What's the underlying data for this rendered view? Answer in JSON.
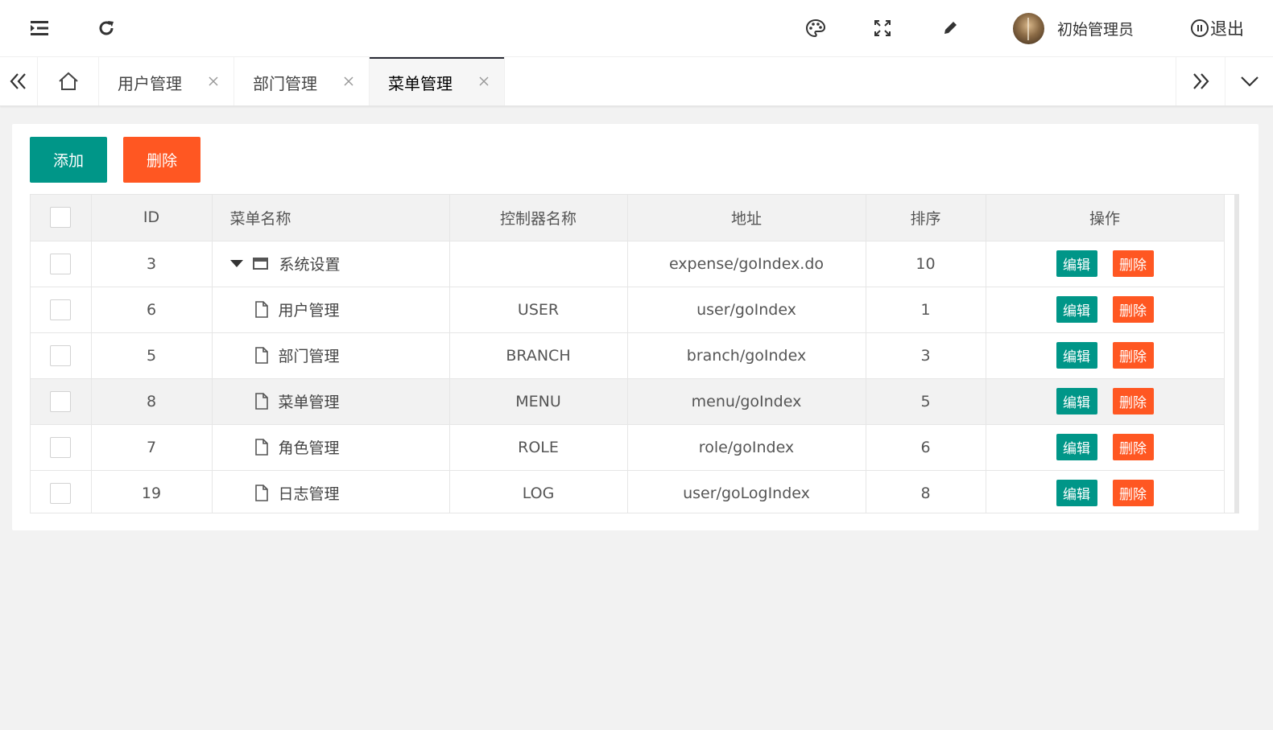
{
  "header": {
    "username": "初始管理员",
    "logout_label": "退出"
  },
  "tabs": [
    {
      "label": "用户管理"
    },
    {
      "label": "部门管理"
    },
    {
      "label": "菜单管理",
      "active": true
    }
  ],
  "toolbar": {
    "add_label": "添加",
    "delete_label": "删除"
  },
  "table": {
    "columns": [
      "ID",
      "菜单名称",
      "控制器名称",
      "地址",
      "排序",
      "操作"
    ],
    "rows": [
      {
        "id": "3",
        "name": "系统设置",
        "controller": "",
        "url": "expense/goIndex.do",
        "sort": "10",
        "type": "folder"
      },
      {
        "id": "6",
        "name": "用户管理",
        "controller": "USER",
        "url": "user/goIndex",
        "sort": "1",
        "type": "file"
      },
      {
        "id": "5",
        "name": "部门管理",
        "controller": "BRANCH",
        "url": "branch/goIndex",
        "sort": "3",
        "type": "file"
      },
      {
        "id": "8",
        "name": "菜单管理",
        "controller": "MENU",
        "url": "menu/goIndex",
        "sort": "5",
        "type": "file"
      },
      {
        "id": "7",
        "name": "角色管理",
        "controller": "ROLE",
        "url": "role/goIndex",
        "sort": "6",
        "type": "file"
      },
      {
        "id": "19",
        "name": "日志管理",
        "controller": "LOG",
        "url": "user/goLogIndex",
        "sort": "8",
        "type": "file"
      }
    ],
    "edit_label": "编辑",
    "delete_label": "删除"
  },
  "colors": {
    "primary": "#009688",
    "danger": "#ff5722"
  }
}
